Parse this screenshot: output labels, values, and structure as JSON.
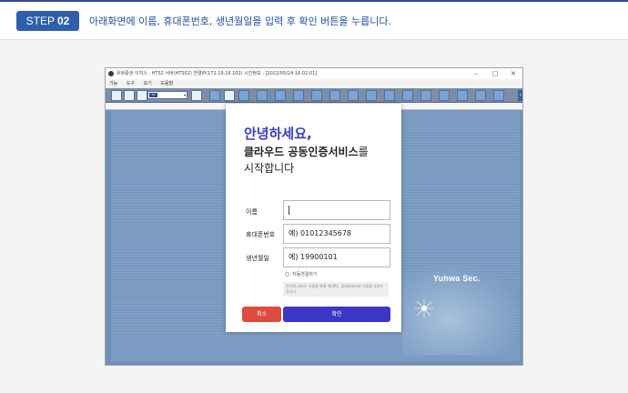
{
  "step": {
    "label": "STEP",
    "number": "02",
    "instruction": "아래화면에 이름, 휴대폰번호, 생년월일을 입력 후 확인 버튼을 누릅니다."
  },
  "app": {
    "title": "유화증권 이지스 : HTS2 서버(HTS02) 연결IP(172.19.16.102)    시간정보 : [2022/05/24 16:02:01]",
    "menu": [
      "기능",
      "도구",
      "보기",
      "도움말"
    ],
    "toolbar_select_tag": "TR",
    "brand": "Yuhwa Sec."
  },
  "modal": {
    "greeting_line1": "안녕하세요,",
    "greeting_line2_bold": "클라우드 공동인증서비스",
    "greeting_line2_rest": "를",
    "greeting_line3": "시작합니다",
    "name_label": "이름",
    "name_value": "",
    "phone_label": "휴대폰번호",
    "phone_value": "예) 01012345678",
    "birth_label": "생년월일",
    "birth_value": "예) 19900101",
    "auto_connect_label": "자동연결하기",
    "notice_text": "안전한 서비스 이용을 위해 개인PC, 모바일에서만 이용을 추천드립니다.",
    "cancel_label": "취소",
    "confirm_label": "확인"
  },
  "colors": {
    "accent": "#2f5fab",
    "confirm": "#3c36c8",
    "cancel": "#e04b3f",
    "greeting": "#3a3fbd"
  }
}
